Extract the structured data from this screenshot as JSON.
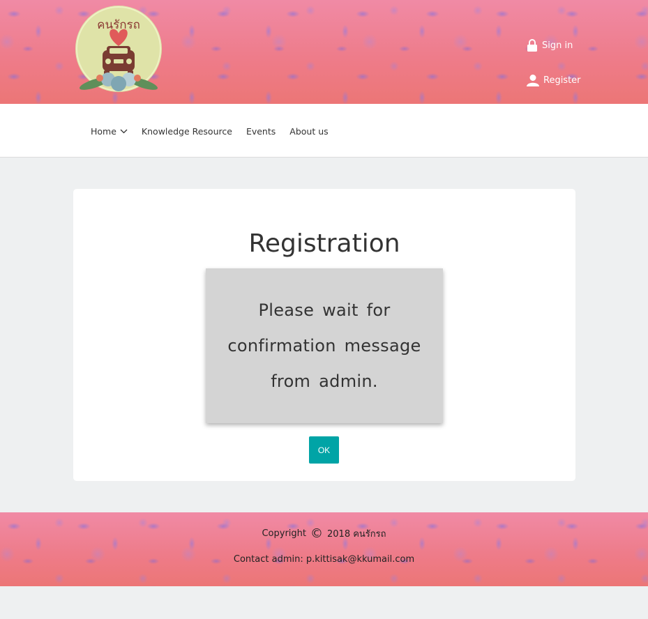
{
  "header": {
    "logo_alt": "คนรักรถ",
    "signin_label": "Sign in",
    "register_label": "Register"
  },
  "nav": {
    "items": [
      {
        "label": "Home",
        "has_dropdown": true
      },
      {
        "label": "Knowledge Resource"
      },
      {
        "label": "Events"
      },
      {
        "label": "About us"
      }
    ]
  },
  "main": {
    "title": "Registration",
    "message": "Please wait for confirmation message from admin.",
    "ok_label": "OK"
  },
  "footer": {
    "copyright_prefix": "Copyright",
    "copyright_symbol": "©",
    "copyright_suffix": "2018 คนรักรถ",
    "contact_prefix": "Contact admin:",
    "contact_email": "p.kittisak@kkumail.com"
  },
  "colors": {
    "banner": "#ef7f94",
    "ok_button": "#00a4a6",
    "message_box": "#d4d4d4",
    "page_bg": "#eef0f1"
  },
  "icons": [
    "lock-icon",
    "user-icon",
    "chevron-down-icon",
    "car-icon",
    "heart-icon"
  ]
}
